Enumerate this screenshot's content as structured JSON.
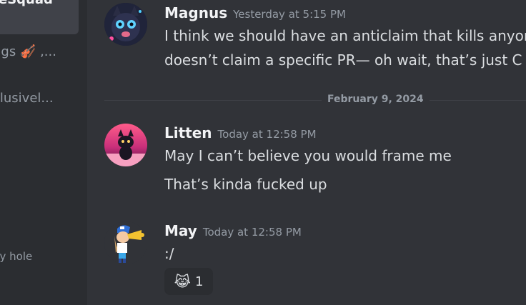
{
  "sidebar": {
    "items": [
      {
        "label": "eSquad"
      },
      {
        "label": "ngs 🎻 ,..."
      },
      {
        "label": "clusivel..."
      },
      {
        "label": "ny hole"
      }
    ]
  },
  "messages": [
    {
      "author": "Magnus",
      "timestamp": "Yesterday at 5:15 PM",
      "lines": [
        "I think we should have an anticlaim that kills anyon",
        "doesn’t claim a specific PR— oh wait, that’s just C"
      ]
    },
    {
      "author": "Litten",
      "timestamp": "Today at 12:58 PM",
      "lines": [
        "May I can’t believe you would frame me",
        "That’s kinda fucked up"
      ]
    },
    {
      "author": "May",
      "timestamp": "Today at 12:58 PM",
      "lines": [
        ":/"
      ],
      "reactions": [
        {
          "emoji": "😹",
          "count": "1"
        }
      ]
    }
  ],
  "divider": {
    "label": "February 9, 2024"
  },
  "colors": {
    "background": "#313338",
    "sidebar": "#2b2d31",
    "author": "#f2f3f5",
    "muted": "#949ba4",
    "text": "#dbdee1"
  }
}
